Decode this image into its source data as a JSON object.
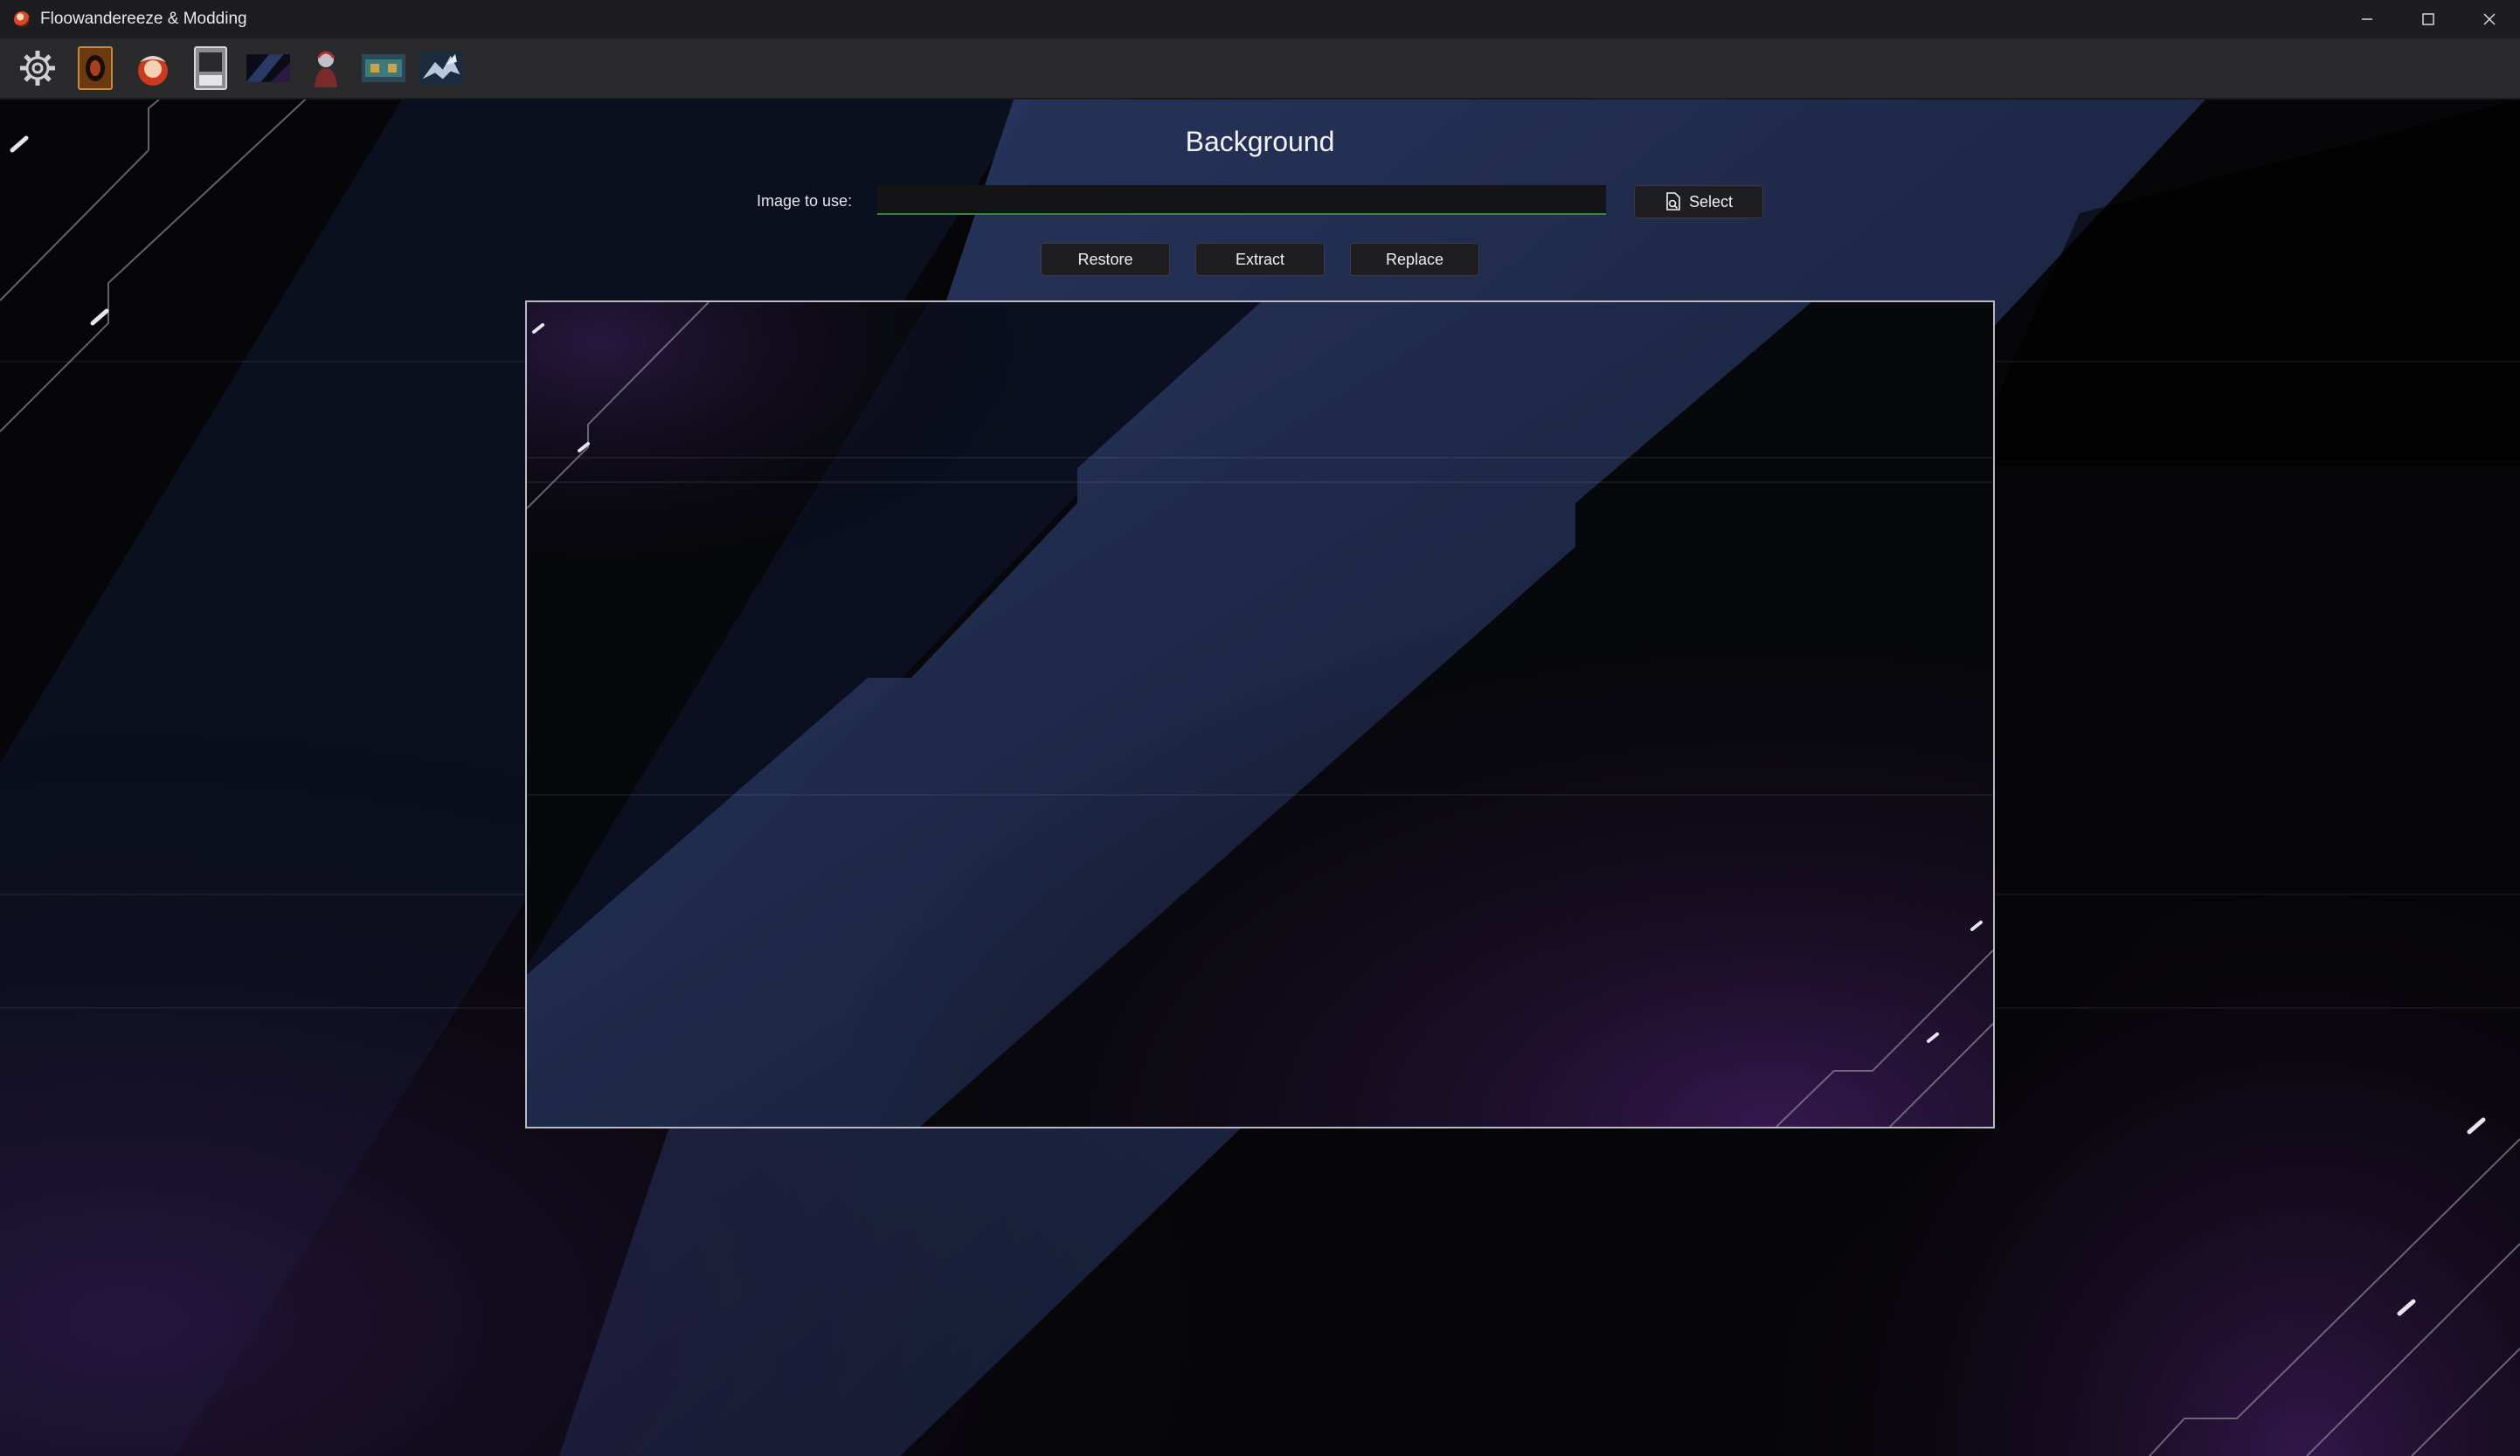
{
  "window": {
    "title": "Floowandereeze & Modding",
    "controls": [
      "minimize-icon",
      "maximize-icon",
      "close-icon"
    ]
  },
  "toolbar": {
    "tools": [
      {
        "name": "settings-tool",
        "icon": "gear-icon"
      },
      {
        "name": "card-back-tool",
        "icon": "card-back-icon"
      },
      {
        "name": "icon-tool",
        "icon": "mascot-icon"
      },
      {
        "name": "card-frame-tool",
        "icon": "card-frame-icon"
      },
      {
        "name": "background-tool",
        "icon": "background-thumbnail-icon"
      },
      {
        "name": "character-tool",
        "icon": "character-icon"
      },
      {
        "name": "field-tool",
        "icon": "field-thumbnail-icon"
      },
      {
        "name": "dragon-tool",
        "icon": "dragon-icon"
      }
    ]
  },
  "main": {
    "heading": "Background",
    "image_field": {
      "label": "Image to use:",
      "value": "",
      "placeholder": ""
    },
    "select_label": "Select",
    "actions": {
      "restore": "Restore",
      "extract": "Extract",
      "replace": "Replace"
    }
  },
  "colors": {
    "accent_green": "#2f8a3a",
    "theme_blue": "#2a3a66",
    "theme_purple": "#3a1a55"
  }
}
